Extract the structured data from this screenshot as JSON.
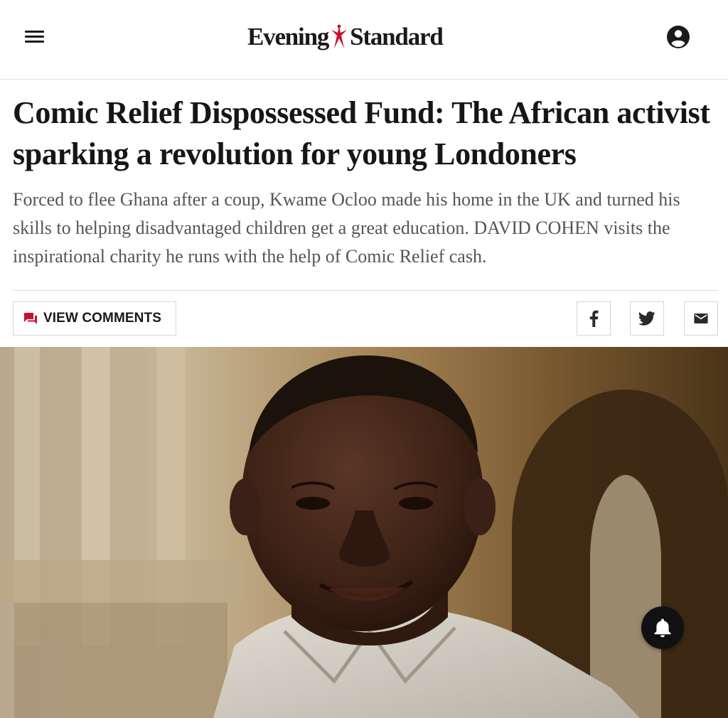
{
  "header": {
    "logo_left": "Evening",
    "logo_right": "Standard",
    "menu_icon": "hamburger-menu-icon",
    "account_icon": "account-circle-icon"
  },
  "article": {
    "headline": "Comic Relief Dispossessed Fund: The African activist sparking a revolution for young Londoners",
    "standfirst": "Forced to flee Ghana after a coup, Kwame Ocloo made his home in the UK and turned his skills to helping disadvantaged children get a great education. DAVID COHEN visits the inspirational charity he runs with the help of Comic Relief cash."
  },
  "actions": {
    "comments_label": "VIEW COMMENTS",
    "comments_icon": "comments-icon",
    "share": [
      {
        "icon": "facebook-icon"
      },
      {
        "icon": "twitter-icon"
      },
      {
        "icon": "email-icon"
      }
    ]
  },
  "notification": {
    "icon": "bell-icon"
  },
  "colors": {
    "accent_red": "#c8102e",
    "text_dark": "#161616",
    "text_grey": "#555555",
    "border": "#d6d6d6"
  }
}
